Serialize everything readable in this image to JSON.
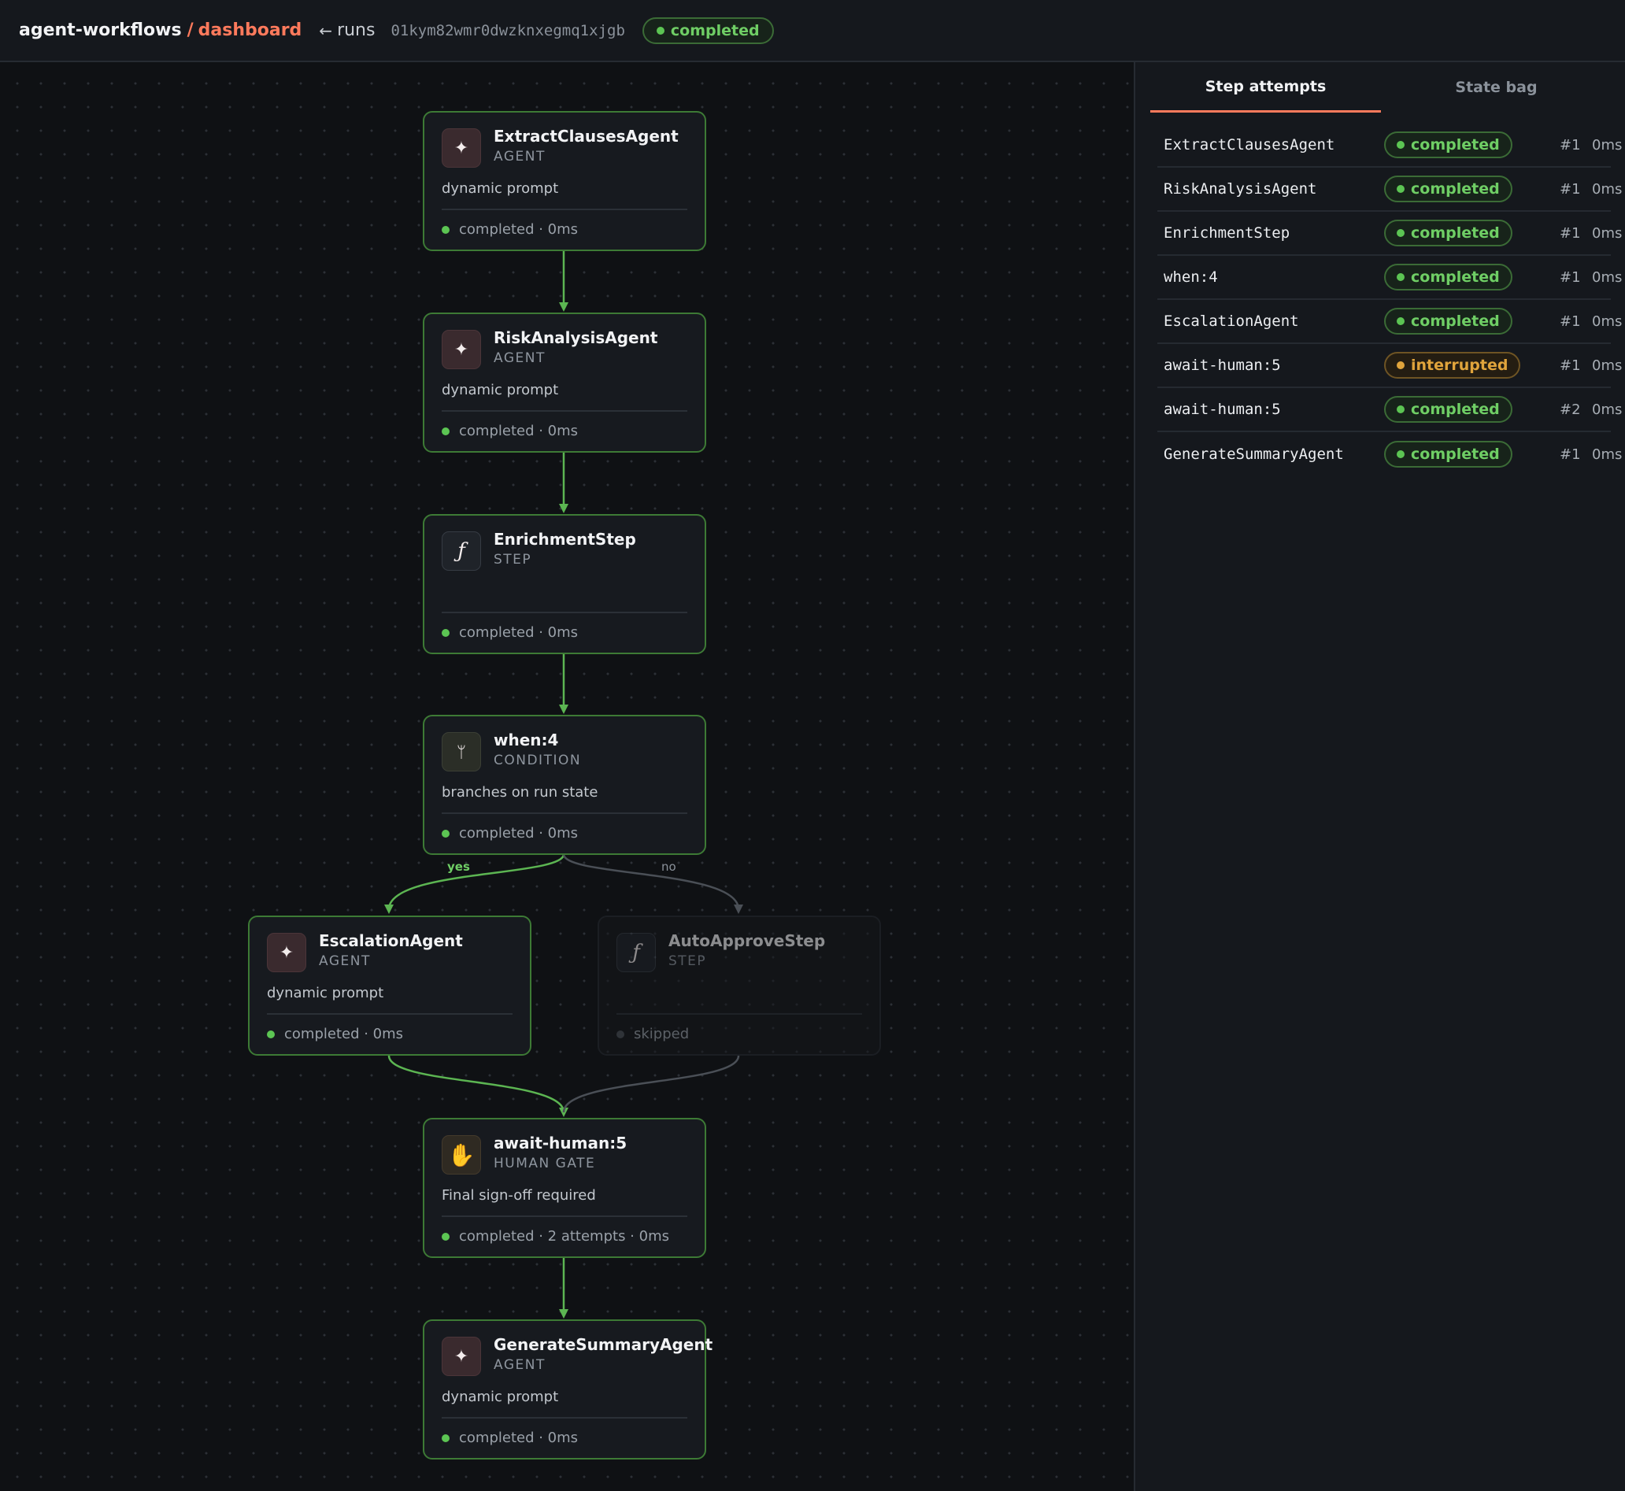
{
  "header": {
    "brand": "agent-workflows",
    "separator": "/",
    "page": "dashboard",
    "back_arrow": "←",
    "back_label": "runs",
    "run_id": "01kym82wmr0dwzknxegmq1xjgb",
    "status": "completed"
  },
  "colors": {
    "accent": "#ff7a5c",
    "success": "#5cc553",
    "warning": "#e0a43c",
    "edge_active": "#5cb552",
    "edge_inactive": "#4a4f56"
  },
  "graph": {
    "edge_labels": {
      "yes": "yes",
      "no": "no"
    },
    "nodes": [
      {
        "title": "ExtractClausesAgent",
        "type": "AGENT",
        "icon": "sparkle-icon",
        "glyph": "✦",
        "desc": "dynamic prompt",
        "status": "completed · 0ms"
      },
      {
        "title": "RiskAnalysisAgent",
        "type": "AGENT",
        "icon": "sparkle-icon",
        "glyph": "✦",
        "desc": "dynamic prompt",
        "status": "completed · 0ms"
      },
      {
        "title": "EnrichmentStep",
        "type": "STEP",
        "icon": "function-icon",
        "glyph": "ƒ",
        "desc": "",
        "status": "completed · 0ms"
      },
      {
        "title": "when:4",
        "type": "CONDITION",
        "icon": "branch-icon",
        "glyph": "ᛘ",
        "desc": "branches on run state",
        "status": "completed · 0ms"
      },
      {
        "title": "EscalationAgent",
        "type": "AGENT",
        "icon": "sparkle-icon",
        "glyph": "✦",
        "desc": "dynamic prompt",
        "status": "completed · 0ms"
      },
      {
        "title": "AutoApproveStep",
        "type": "STEP",
        "icon": "function-icon",
        "glyph": "ƒ",
        "desc": "",
        "status": "skipped"
      },
      {
        "title": "await-human:5",
        "type": "HUMAN GATE",
        "icon": "hand-icon",
        "glyph": "✋",
        "desc": "Final sign-off required",
        "status": "completed · 2 attempts · 0ms"
      },
      {
        "title": "GenerateSummaryAgent",
        "type": "AGENT",
        "icon": "sparkle-icon",
        "glyph": "✦",
        "desc": "dynamic prompt",
        "status": "completed · 0ms"
      }
    ]
  },
  "panel": {
    "tabs": [
      {
        "label": "Step attempts",
        "active": true
      },
      {
        "label": "State bag",
        "active": false
      }
    ],
    "attempts": [
      {
        "name": "ExtractClausesAgent",
        "status": "completed",
        "attempt": "#1",
        "duration": "0ms"
      },
      {
        "name": "RiskAnalysisAgent",
        "status": "completed",
        "attempt": "#1",
        "duration": "0ms"
      },
      {
        "name": "EnrichmentStep",
        "status": "completed",
        "attempt": "#1",
        "duration": "0ms"
      },
      {
        "name": "when:4",
        "status": "completed",
        "attempt": "#1",
        "duration": "0ms"
      },
      {
        "name": "EscalationAgent",
        "status": "completed",
        "attempt": "#1",
        "duration": "0ms"
      },
      {
        "name": "await-human:5",
        "status": "interrupted",
        "attempt": "#1",
        "duration": "0ms"
      },
      {
        "name": "await-human:5",
        "status": "completed",
        "attempt": "#2",
        "duration": "0ms"
      },
      {
        "name": "GenerateSummaryAgent",
        "status": "completed",
        "attempt": "#1",
        "duration": "0ms"
      }
    ]
  }
}
